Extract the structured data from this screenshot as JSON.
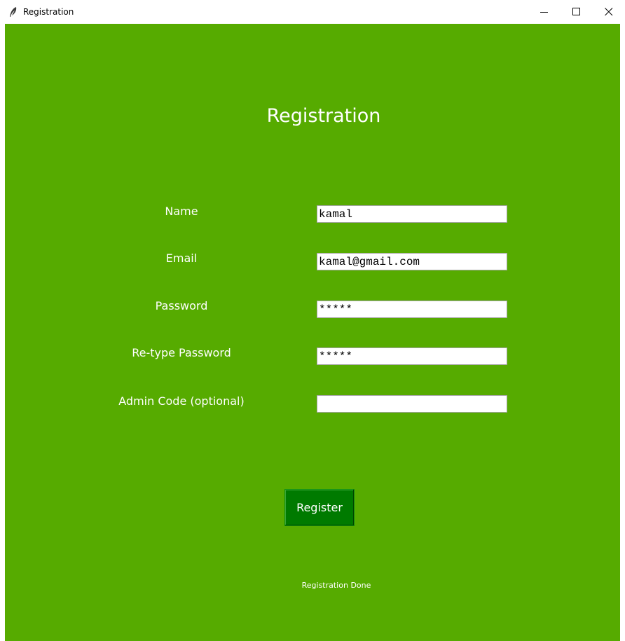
{
  "window": {
    "title": "Registration",
    "icon": "feather-icon"
  },
  "form": {
    "heading": "Registration",
    "fields": [
      {
        "label": "Name",
        "value": "kamal"
      },
      {
        "label": "Email",
        "value": "kamal@gmail.com"
      },
      {
        "label": "Password",
        "value": "*****"
      },
      {
        "label": "Re-type Password",
        "value": "*****"
      },
      {
        "label": "Admin Code (optional)",
        "value": ""
      }
    ],
    "register_label": "Register",
    "status": "Registration Done"
  },
  "colors": {
    "background": "#56ab00",
    "button": "#007a00",
    "text": "#ffffff"
  }
}
